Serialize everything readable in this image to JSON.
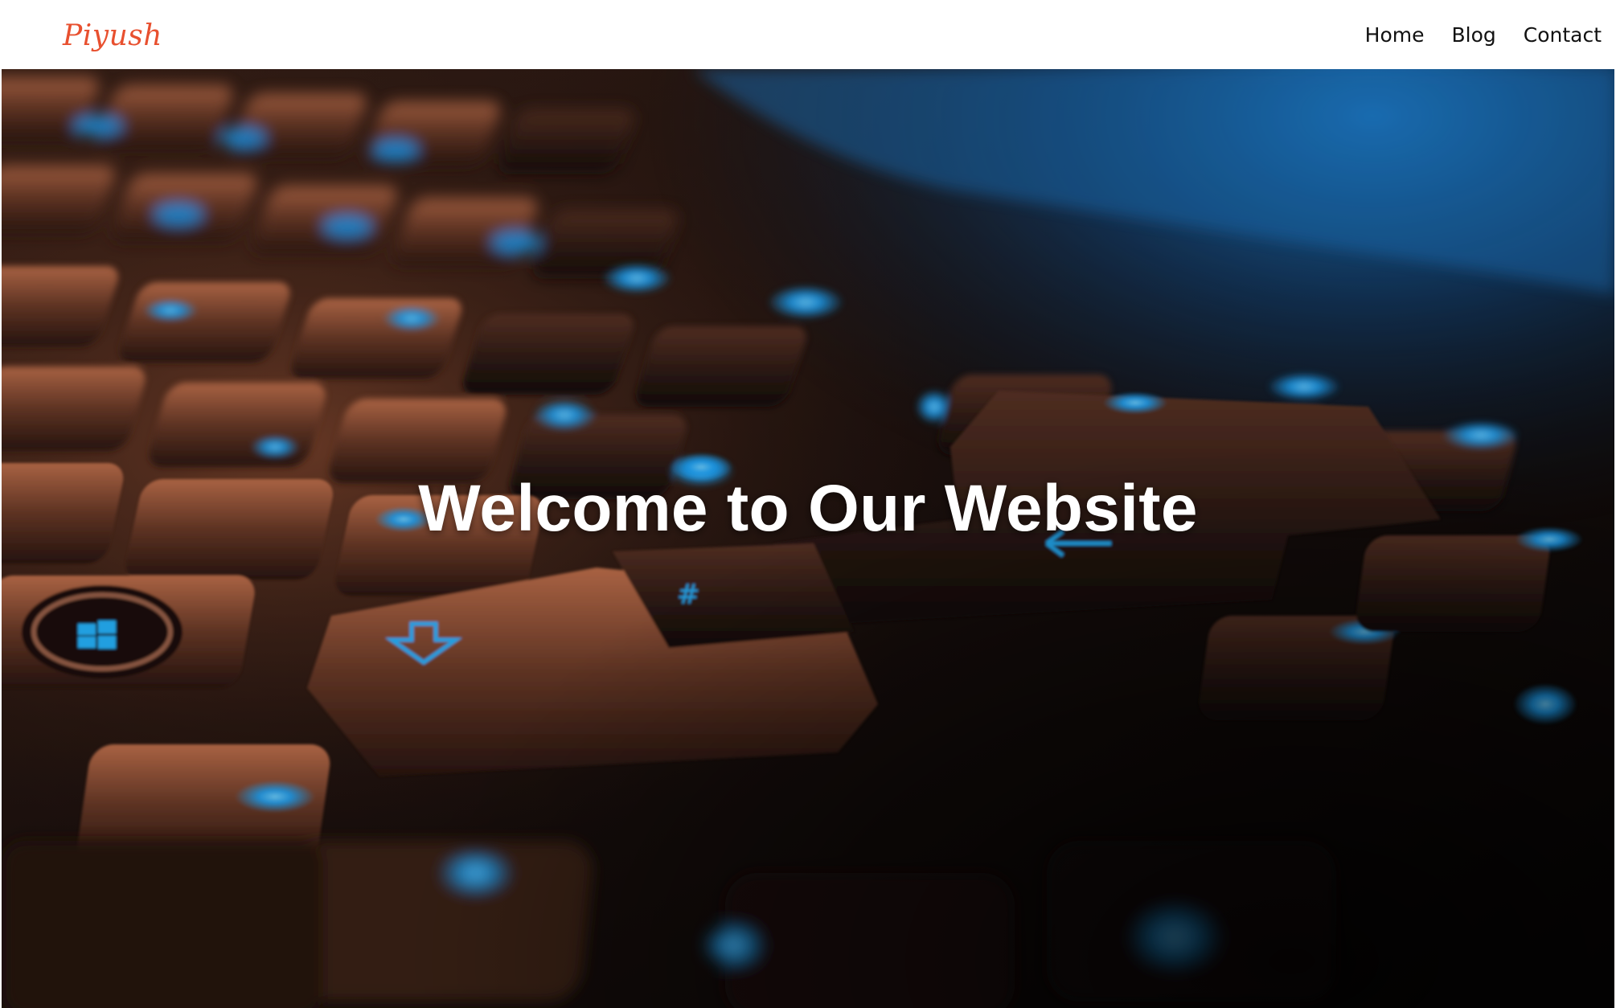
{
  "header": {
    "brand": "Piyush",
    "nav": [
      {
        "label": "Home"
      },
      {
        "label": "Blog"
      },
      {
        "label": "Contact"
      }
    ]
  },
  "hero": {
    "title": "Welcome to Our Website",
    "background_image": "keyboard-photo",
    "colors": {
      "brand": "#e8502f",
      "key_glow": "#1ea8ff",
      "key_highlight": "#c8704a"
    }
  }
}
